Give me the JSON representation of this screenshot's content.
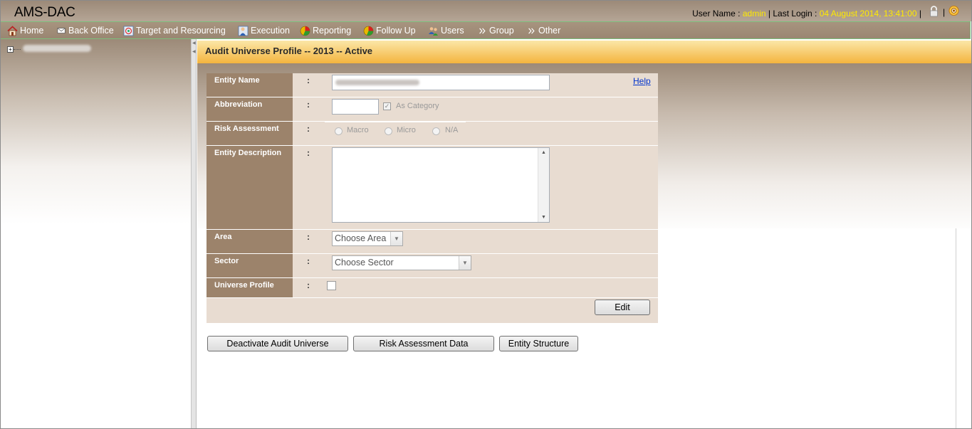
{
  "app": {
    "title": "AMS-DAC",
    "user_label": "User Name :",
    "user_name": "admin",
    "last_login_label": "Last Login :",
    "last_login": "04 August 2014, 13:41:00",
    "separator": "|"
  },
  "icons": {
    "lock": "lock-icon",
    "logout": "logout-icon",
    "home": "home-icon",
    "back_office": "envelope-icon",
    "target": "target-icon",
    "execution": "person-icon",
    "reporting": "pie-chart-icon",
    "follow_up": "pie-chart-icon",
    "users": "users-icon",
    "group": "chevron-double-icon",
    "other": "chevron-double-icon"
  },
  "menu": {
    "home": "Home",
    "back_office": "Back Office",
    "target_resourcing": "Target and Resourcing",
    "execution": "Execution",
    "reporting": "Reporting",
    "follow_up": "Follow Up",
    "users": "Users",
    "group": "Group",
    "other": "Other"
  },
  "page": {
    "title": "Audit Universe Profile -- 2013 -- Active"
  },
  "form": {
    "entity_name_label": "Entity Name",
    "abbreviation_label": "Abbreviation",
    "risk_assessment_label": "Risk Assessment",
    "entity_description_label": "Entity Description",
    "area_label": "Area",
    "sector_label": "Sector",
    "universe_profile_label": "Universe Profile",
    "colon": ":",
    "help_link": "Help",
    "as_category_label": "As Category",
    "risk_options": [
      "Macro",
      "Micro",
      "N/A"
    ],
    "area_selected": "Choose Area",
    "sector_selected": "Choose Sector",
    "edit_button": "Edit"
  },
  "actions": {
    "deactivate": "Deactivate Audit Universe",
    "risk_data": "Risk Assessment Data",
    "entity_structure": "Entity Structure"
  },
  "colors": {
    "header_brown": "#9c8a78",
    "label_brown": "#9c836b",
    "form_bg": "#e8dcd1",
    "title_orange": "#f4b43e",
    "highlight_yellow": "#ffea00"
  }
}
